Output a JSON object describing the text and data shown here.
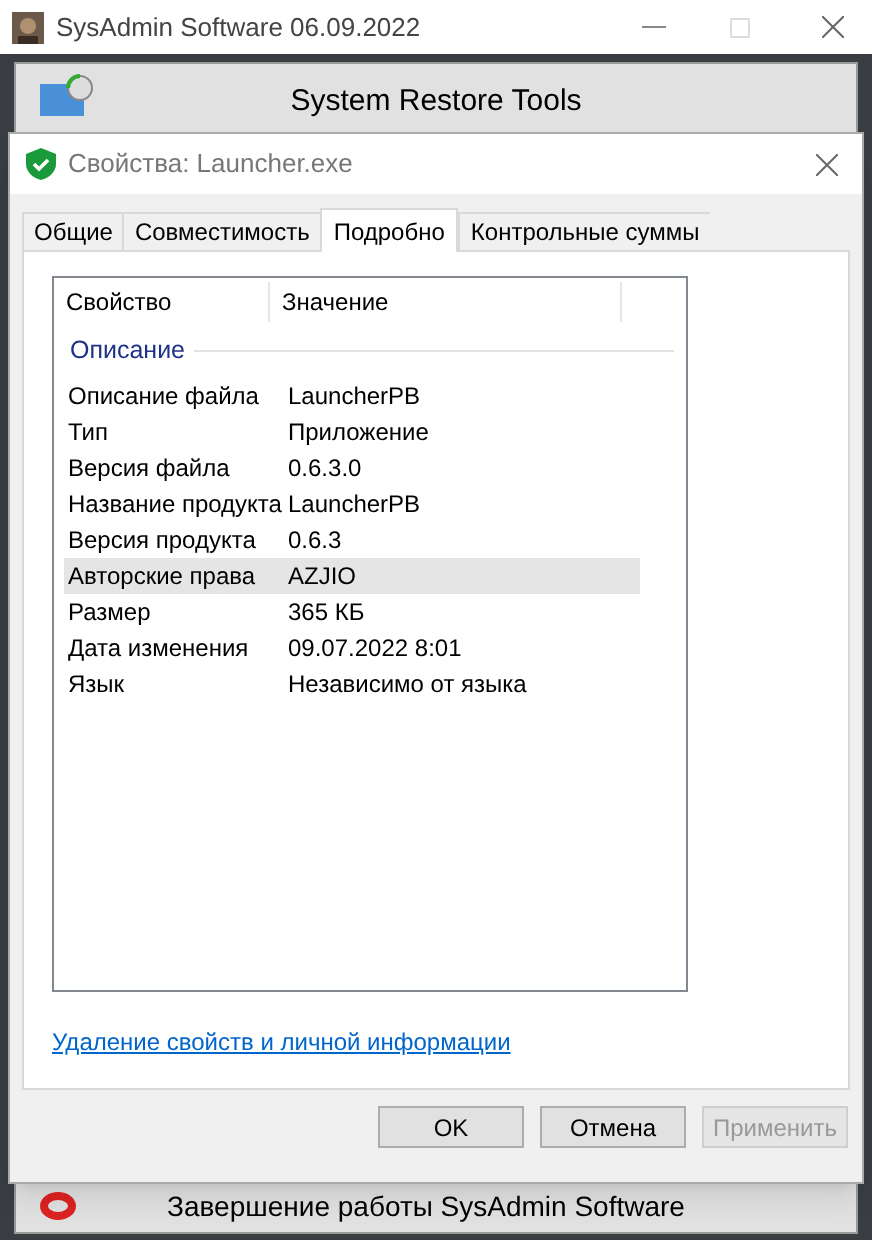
{
  "app_window": {
    "title": "SysAdmin Software 06.09.2022",
    "top_button": "System Restore Tools",
    "bottom_button": "Завершение работы SysAdmin Software"
  },
  "dialog": {
    "title": "Свойства: Launcher.exe",
    "tabs": [
      {
        "label": "Общие",
        "selected": false
      },
      {
        "label": "Совместимость",
        "selected": false
      },
      {
        "label": "Подробно",
        "selected": true
      },
      {
        "label": "Контрольные суммы",
        "selected": false
      }
    ],
    "columns": [
      "Свойство",
      "Значение"
    ],
    "group": "Описание",
    "rows": [
      {
        "property": "Описание файла",
        "value": "LauncherPB",
        "selected": false
      },
      {
        "property": "Тип",
        "value": "Приложение",
        "selected": false
      },
      {
        "property": "Версия файла",
        "value": "0.6.3.0",
        "selected": false
      },
      {
        "property": "Название продукта",
        "value": "LauncherPB",
        "selected": false
      },
      {
        "property": "Версия продукта",
        "value": "0.6.3",
        "selected": false
      },
      {
        "property": "Авторские права",
        "value": "AZJIO",
        "selected": true
      },
      {
        "property": "Размер",
        "value": "365 КБ",
        "selected": false
      },
      {
        "property": "Дата изменения",
        "value": "09.07.2022 8:01",
        "selected": false
      },
      {
        "property": "Язык",
        "value": "Независимо от языка",
        "selected": false
      }
    ],
    "link": "Удаление свойств и личной информации",
    "buttons": [
      {
        "label": "OK",
        "disabled": false
      },
      {
        "label": "Отмена",
        "disabled": false
      },
      {
        "label": "Применить",
        "disabled": true
      }
    ]
  }
}
